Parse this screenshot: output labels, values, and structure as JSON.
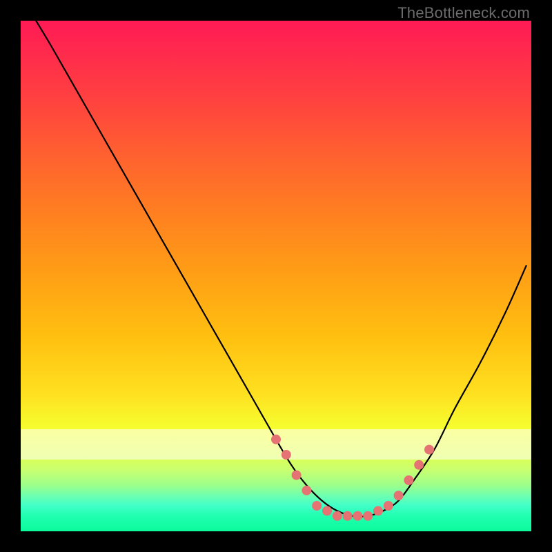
{
  "watermark": "TheBottleneck.com",
  "chart_data": {
    "type": "line",
    "title": "",
    "xlabel": "",
    "ylabel": "",
    "xlim": [
      0,
      100
    ],
    "ylim": [
      0,
      100
    ],
    "grid": false,
    "legend": false,
    "series": [
      {
        "name": "bottleneck-curve",
        "color": "#000000",
        "x": [
          3,
          6,
          10,
          14,
          18,
          22,
          26,
          30,
          34,
          38,
          42,
          46,
          50,
          53,
          56,
          59,
          62,
          65,
          68,
          71,
          74,
          77,
          81,
          85,
          90,
          95,
          99
        ],
        "y": [
          100,
          95,
          88,
          81,
          74,
          67,
          60,
          53,
          46,
          39,
          32,
          25,
          18,
          13,
          9,
          6,
          4,
          3,
          3,
          4,
          6,
          10,
          16,
          24,
          33,
          43,
          52
        ]
      }
    ],
    "markers": {
      "name": "fit-points",
      "color": "#e57373",
      "radius": 7,
      "points": [
        {
          "x": 50,
          "y": 18
        },
        {
          "x": 52,
          "y": 15
        },
        {
          "x": 54,
          "y": 11
        },
        {
          "x": 56,
          "y": 8
        },
        {
          "x": 58,
          "y": 5
        },
        {
          "x": 60,
          "y": 4
        },
        {
          "x": 62,
          "y": 3
        },
        {
          "x": 64,
          "y": 3
        },
        {
          "x": 66,
          "y": 3
        },
        {
          "x": 68,
          "y": 3
        },
        {
          "x": 70,
          "y": 4
        },
        {
          "x": 72,
          "y": 5
        },
        {
          "x": 74,
          "y": 7
        },
        {
          "x": 76,
          "y": 10
        },
        {
          "x": 78,
          "y": 13
        },
        {
          "x": 80,
          "y": 16
        }
      ]
    },
    "white_band": {
      "top_pct": 80,
      "height_pct": 6
    }
  }
}
